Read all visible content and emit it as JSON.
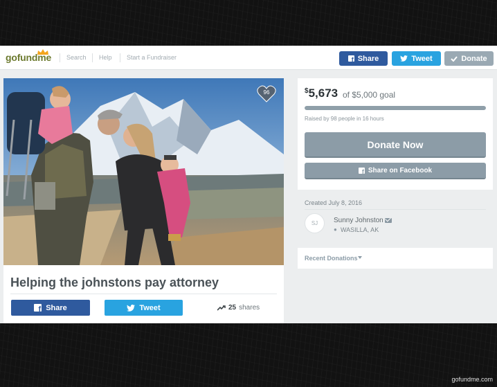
{
  "header": {
    "logo": "gofundme",
    "nav": [
      "Search",
      "Help",
      "Start a Fundraiser"
    ],
    "share_label": "Share",
    "tweet_label": "Tweet",
    "donate_label": "Donate"
  },
  "campaign": {
    "title": "Helping the johnstons pay attorney",
    "heart_count": "96",
    "share_label": "Share",
    "tweet_label": "Tweet",
    "shares_count": "25",
    "shares_label": "shares"
  },
  "donation": {
    "currency": "$",
    "amount": "5,673",
    "goal_text": "of $5,000 goal",
    "progress_fraction": 1.0,
    "raised_text": "Raised by 98 people in 16 hours",
    "donate_now_label": "Donate Now",
    "share_fb_label": "Share on Facebook"
  },
  "organizer": {
    "created": "Created July 8, 2016",
    "initials": "SJ",
    "name": "Sunny Johnston",
    "location": "WASILLA, AK"
  },
  "recent": {
    "label": "Recent Donations"
  },
  "watermark": "gofundme.com",
  "colors": {
    "facebook": "#2f5a9e",
    "twitter": "#29a3e0",
    "muted_button": "#8c9ca7",
    "brand": "#6c7a2f"
  }
}
